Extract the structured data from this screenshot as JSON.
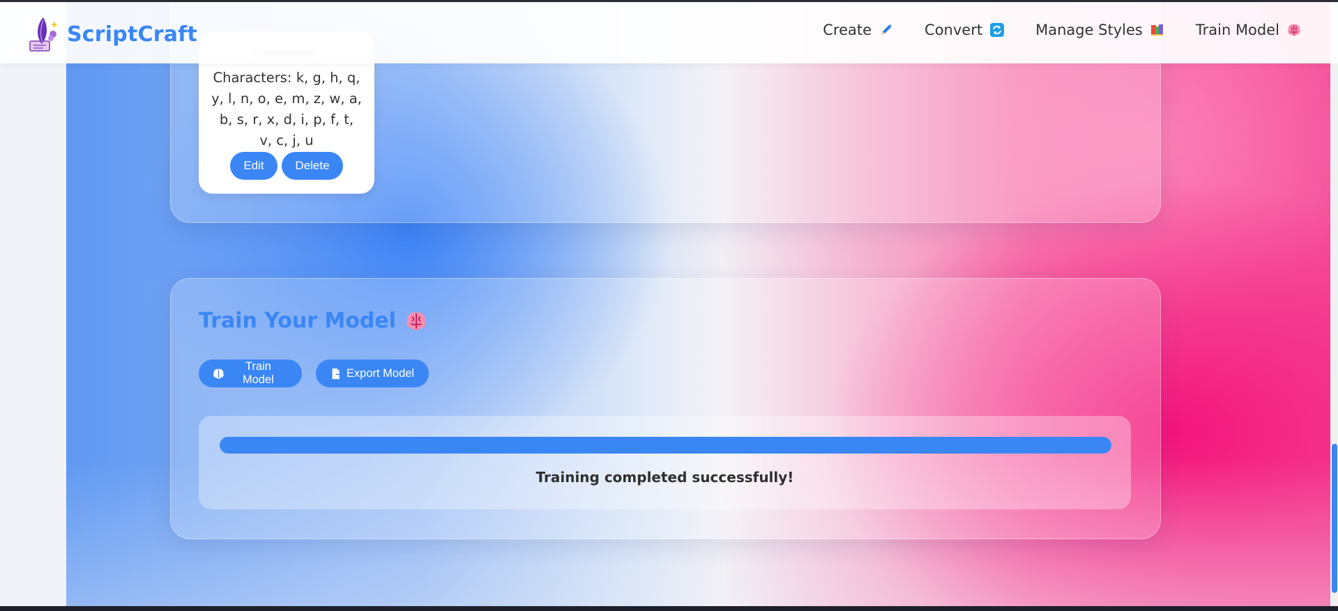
{
  "brand": {
    "name": "ScriptCraft",
    "logo_icon": "quill-pen-logo-icon"
  },
  "nav": {
    "items": [
      {
        "label": "Create",
        "icon": "pencil-icon"
      },
      {
        "label": "Convert",
        "icon": "refresh-icon"
      },
      {
        "label": "Manage Styles",
        "icon": "books-icon"
      },
      {
        "label": "Train Model",
        "icon": "brain-icon"
      }
    ]
  },
  "styles_section": {
    "style_card": {
      "characters_text": "Characters: k, g, h, q, y, l, n, o, e, m, z, w, a, b, s, r, x, d, i, p, f, t, v, c, j, u",
      "edit_label": "Edit",
      "delete_label": "Delete"
    }
  },
  "train_section": {
    "title": "Train Your Model",
    "title_icon": "brain-icon",
    "train_button_label": "Train Model",
    "export_button_label": "Export Model",
    "progress_fraction": 1.0,
    "status_text": "Training completed successfully!"
  },
  "colors": {
    "accent": "#3a86f5",
    "pink": "#f4147a",
    "text": "#333333"
  }
}
